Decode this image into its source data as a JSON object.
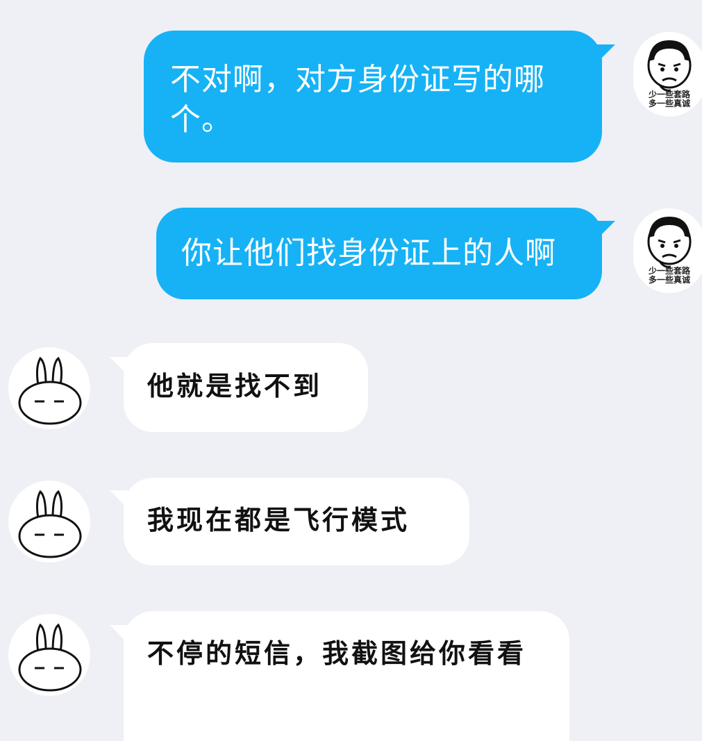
{
  "messages": [
    {
      "side": "outgoing",
      "text": "不对啊，对方身份证写的哪个。",
      "avatar": {
        "icon": "meme-boy-avatar-icon",
        "caption_line1": "少一些套路",
        "caption_line2": "多一些真诚"
      }
    },
    {
      "side": "outgoing",
      "text": "你让他们找身份证上的人啊",
      "avatar": {
        "icon": "meme-boy-avatar-icon",
        "caption_line1": "少一些套路",
        "caption_line2": "多一些真诚"
      }
    },
    {
      "side": "incoming",
      "text": "他就是找不到",
      "avatar": {
        "icon": "rabbit-avatar-icon"
      }
    },
    {
      "side": "incoming",
      "text": "我现在都是飞行模式",
      "avatar": {
        "icon": "rabbit-avatar-icon"
      }
    },
    {
      "side": "incoming",
      "text": "不停的短信，我截图给你看看",
      "avatar": {
        "icon": "rabbit-avatar-icon"
      }
    }
  ],
  "colors": {
    "background": "#eef0f5",
    "outgoing_bubble": "#16b2f5",
    "incoming_bubble": "#ffffff"
  }
}
